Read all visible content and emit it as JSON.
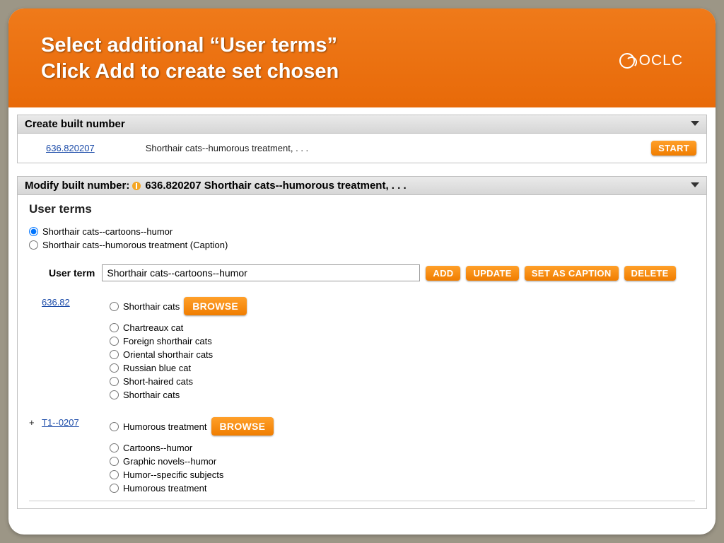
{
  "header": {
    "title_line1": "Select additional “User terms”",
    "title_line2": "Click Add to create set chosen",
    "brand": "OCLC"
  },
  "create_panel": {
    "title": "Create built number",
    "number": "636.820207",
    "description": "Shorthair cats--humorous treatment, . . .",
    "start_label": "START"
  },
  "modify_panel": {
    "title_prefix": "Modify built number:",
    "title_value": "636.820207 Shorthair cats--humorous treatment, . . .",
    "section_title": "User terms",
    "radios": [
      {
        "label": "Shorthair cats--cartoons--humor",
        "checked": true
      },
      {
        "label": "Shorthair cats--humorous treatment  (Caption)",
        "checked": false
      }
    ],
    "userterm_label": "User term",
    "userterm_value": "Shorthair cats--cartoons--humor",
    "buttons": {
      "add": "ADD",
      "update": "UPDATE",
      "set_caption": "SET AS CAPTION",
      "delete": "DELETE"
    },
    "blocks": [
      {
        "plus": "",
        "code": "636.82",
        "head": "Shorthair cats",
        "browse": "BROWSE",
        "options": [
          "Chartreaux cat",
          "Foreign shorthair cats",
          "Oriental shorthair cats",
          "Russian blue cat",
          "Short-haired cats",
          "Shorthair cats"
        ]
      },
      {
        "plus": "+",
        "code": "T1--0207",
        "head": "Humorous treatment",
        "browse": "BROWSE",
        "options": [
          "Cartoons--humor",
          "Graphic novels--humor",
          "Humor--specific subjects",
          "Humorous treatment"
        ]
      }
    ]
  }
}
